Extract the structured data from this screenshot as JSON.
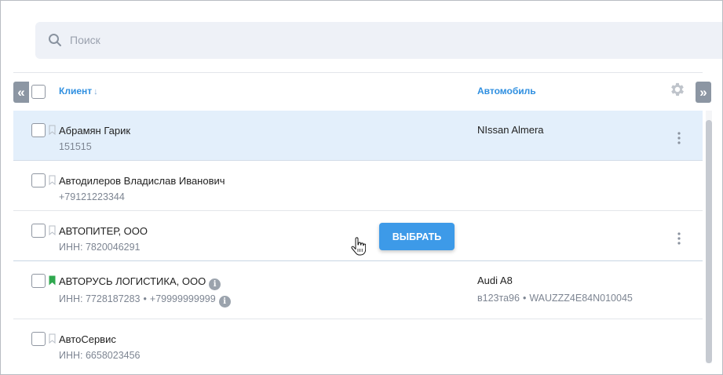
{
  "search": {
    "placeholder": "Поиск"
  },
  "table": {
    "columns": {
      "client": "Клиент",
      "client_sort": "↓",
      "car": "Автомобиль"
    },
    "nav": {
      "prev": "«",
      "next": "»"
    },
    "rows": [
      {
        "name": "Абрамян Гарик",
        "sub": "151515",
        "car": "NIssan Almera",
        "car_sub": "",
        "selected": true,
        "bookmarked": false
      },
      {
        "name": "Автодилеров Владислав Иванович",
        "sub": "+79121223344",
        "car": "",
        "car_sub": "",
        "selected": false,
        "bookmarked": false
      },
      {
        "name": "АВТОПИТЕР, ООО",
        "sub": "ИНН: 7820046291",
        "car": "",
        "car_sub": "",
        "selected": false,
        "bookmarked": false
      },
      {
        "name": "АВТОРУСЬ ЛОГИСТИКА, ООО",
        "sub_inn": "ИНН: 7728187283",
        "sub_phone": "+79999999999",
        "car": "Audi A8",
        "car_plate": "в123та96",
        "car_vin": "WAUZZZ4E84N010045",
        "selected": false,
        "bookmarked": true
      },
      {
        "name": "АвтоСервис",
        "sub": "ИНН: 6658023456",
        "car": "",
        "car_sub": "",
        "selected": false,
        "bookmarked": false
      }
    ],
    "select_button": "ВЫБРАТЬ",
    "separator": "•",
    "info_glyph": "i"
  },
  "colors": {
    "accent": "#2f8fe0",
    "button": "#3d9ae8",
    "selected_row": "#e3effb",
    "bookmark_active": "#2fa84f",
    "nav": "#8c96a3"
  },
  "icons": {
    "search": "search-icon",
    "gear": "gear-icon",
    "kebab": "more-vertical-icon",
    "bookmark": "bookmark-icon",
    "info": "info-icon",
    "cursor": "hand-pointer-icon"
  }
}
